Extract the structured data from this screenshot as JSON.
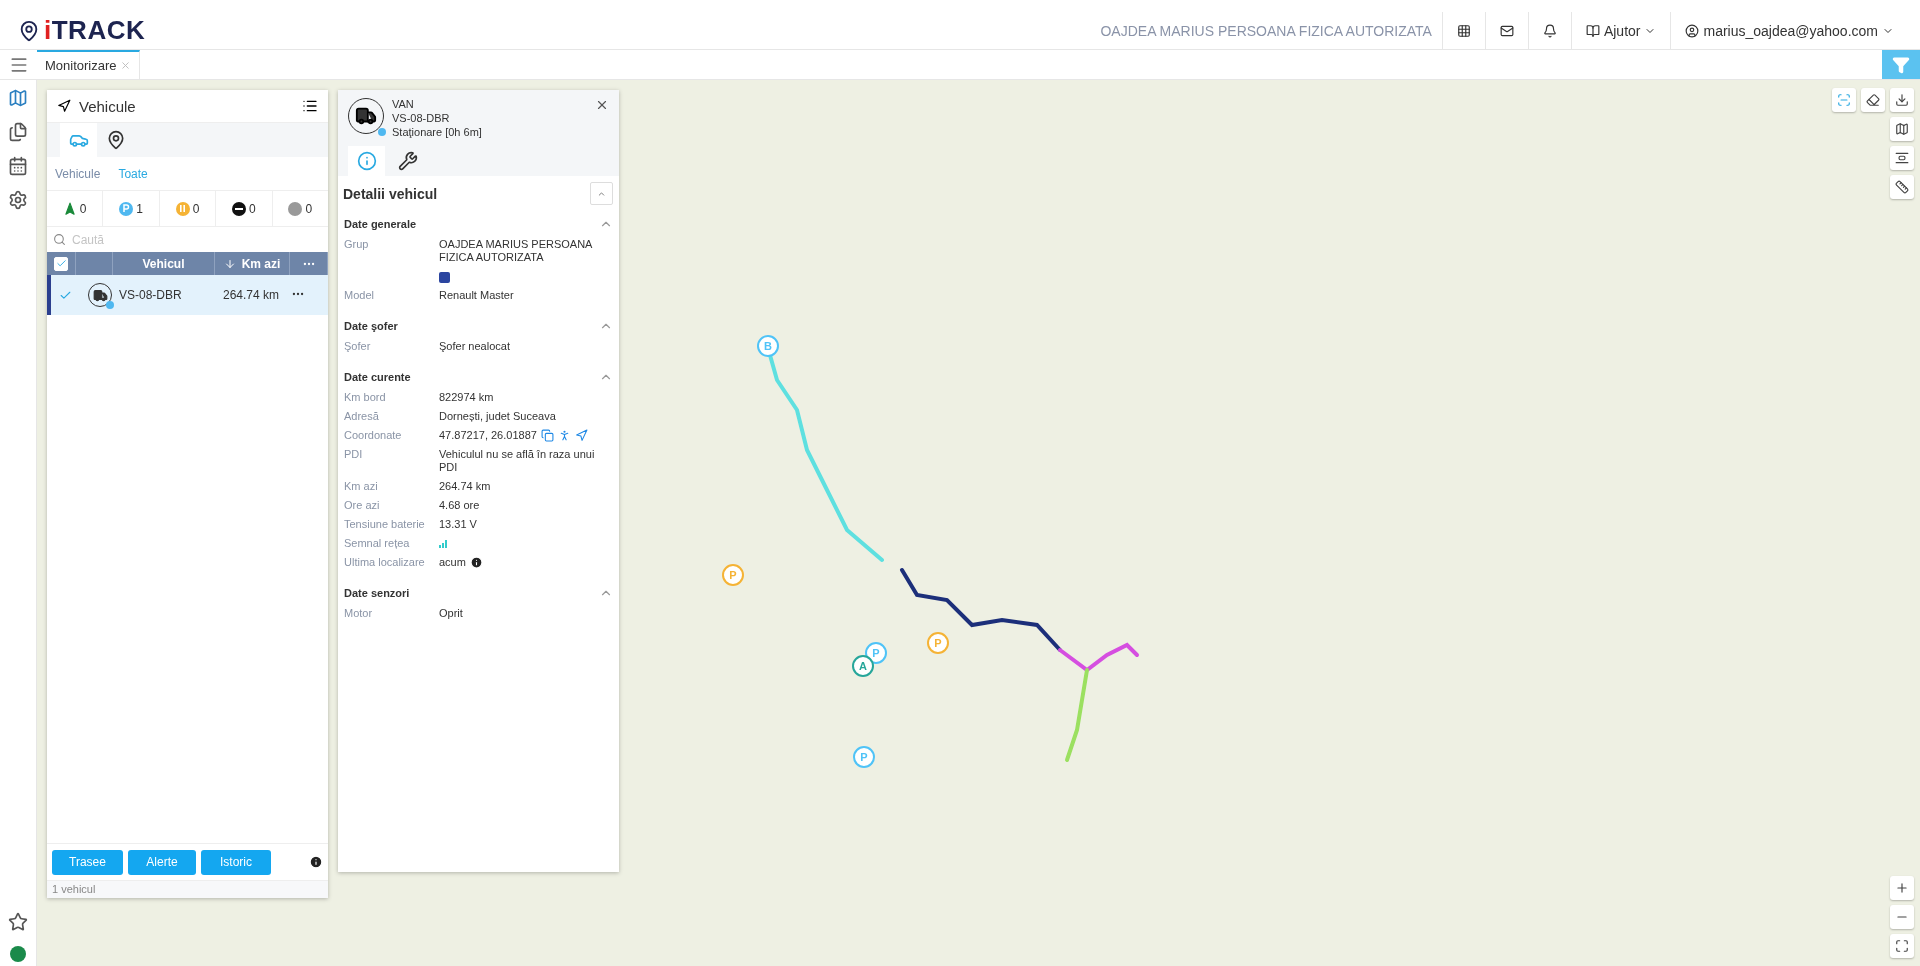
{
  "header": {
    "logo_accent": "i",
    "logo_text": "TRACK",
    "company": "OAJDEA MARIUS PERSOANA FIZICA AUTORIZATA",
    "help": "Ajutor",
    "user": "marius_oajdea@yahoo.com"
  },
  "tabs": [
    {
      "label": "Monitorizare",
      "selected": true
    }
  ],
  "vehicles_panel": {
    "title": "Vehicule",
    "icon_tabs": [
      {
        "kind": "car",
        "selected": true
      },
      {
        "kind": "pin",
        "selected": false
      }
    ],
    "filter_links": [
      {
        "label": "Vehicule",
        "selected": false
      },
      {
        "label": "Toate",
        "selected": true
      }
    ],
    "status_counts": [
      {
        "kind": "moving",
        "count": "0"
      },
      {
        "kind": "parked",
        "count": "1"
      },
      {
        "kind": "paused",
        "count": "0"
      },
      {
        "kind": "stopped",
        "count": "0"
      },
      {
        "kind": "no_signal",
        "count": "0"
      }
    ],
    "search": {
      "placeholder": "Caută"
    },
    "table": {
      "all_checked": true,
      "columns": [
        "Vehicul",
        "Km azi"
      ],
      "rows": [
        {
          "plate": "VS-08-DBR",
          "km": "264.74 km",
          "checked": true,
          "selected": true
        }
      ]
    },
    "buttons": [
      "Trasee",
      "Alerte",
      "Istoric"
    ],
    "footer": "1 vehicul"
  },
  "detail_panel": {
    "type": "VAN",
    "plate": "VS-08-DBR",
    "status": "Staţionare [0h 6m]",
    "tabs": [
      {
        "kind": "info",
        "selected": true
      },
      {
        "kind": "tools",
        "selected": false
      }
    ],
    "title": "Detalii vehicul",
    "sections": [
      {
        "title": "Date generale",
        "expanded": true,
        "rows": [
          {
            "kind": "group",
            "label": "Grup",
            "value": "OAJDEA MARIUS PERSOANA FIZICA AUTORIZATA",
            "color": "#2b45a0"
          },
          {
            "kind": "text",
            "label": "Model",
            "value": "Renault Master"
          }
        ]
      },
      {
        "title": "Date şofer",
        "expanded": true,
        "rows": [
          {
            "kind": "text",
            "label": "Şofer",
            "value": "Şofer nealocat"
          }
        ]
      },
      {
        "title": "Date curente",
        "expanded": true,
        "rows": [
          {
            "kind": "text",
            "label": "Km bord",
            "value": "822974 km"
          },
          {
            "kind": "text",
            "label": "Adresă",
            "value": "Dornești, judet Suceava"
          },
          {
            "kind": "coords",
            "label": "Coordonate",
            "value": "47.87217, 26.01887"
          },
          {
            "kind": "text",
            "label": "PDI",
            "value": "Vehiculul nu se află în raza unui PDI"
          },
          {
            "kind": "text",
            "label": "Km azi",
            "value": "264.74 km"
          },
          {
            "kind": "text",
            "label": "Ore azi",
            "value": "4.68 ore"
          },
          {
            "kind": "text",
            "label": "Tensiune baterie",
            "value": "13.31 V"
          },
          {
            "kind": "signal",
            "label": "Semnal rețea"
          },
          {
            "kind": "info",
            "label": "Ultima localizare",
            "value": "acum"
          }
        ]
      },
      {
        "title": "Date senzori",
        "expanded": true,
        "rows": [
          {
            "kind": "text",
            "label": "Motor",
            "value": "Oprit"
          }
        ]
      }
    ]
  },
  "map": {
    "markers": [
      {
        "label": "B",
        "color": "#4fc3f7"
      },
      {
        "label": "P",
        "color": "#f5b335"
      },
      {
        "label": "P",
        "color": "#4fc3f7"
      },
      {
        "label": "A",
        "color": "#26a69a"
      },
      {
        "label": "P",
        "color": "#f5b335"
      },
      {
        "label": "P",
        "color": "#4fc3f7"
      }
    ]
  }
}
